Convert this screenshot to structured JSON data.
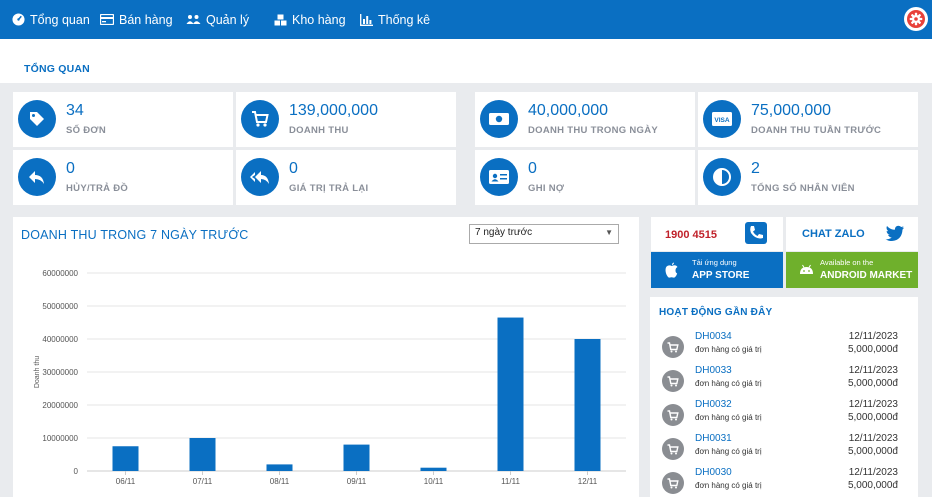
{
  "nav": {
    "items": [
      {
        "label": "Tổng quan",
        "icon": "dashboard-icon"
      },
      {
        "label": "Bán hàng",
        "icon": "card-icon"
      },
      {
        "label": "Quản lý",
        "icon": "users-icon"
      },
      {
        "label": "Kho hàng",
        "icon": "boxes-icon"
      },
      {
        "label": "Thống kê",
        "icon": "bar-chart-icon"
      }
    ],
    "settings_icon": "gear-icon"
  },
  "page": {
    "title": "TỔNG QUAN"
  },
  "stats": [
    {
      "value": "34",
      "label": "SỐ ĐƠN",
      "icon": "tag-icon"
    },
    {
      "value": "139,000,000",
      "label": "DOANH THU",
      "icon": "cart-icon"
    },
    {
      "value": "40,000,000",
      "label": "DOANH THU TRONG NGÀY",
      "icon": "money-icon"
    },
    {
      "value": "75,000,000",
      "label": "DOANH THU TUẦN TRƯỚC",
      "icon": "visa-icon"
    },
    {
      "value": "0",
      "label": "HỦY/TRẢ ĐỒ",
      "icon": "reply-icon"
    },
    {
      "value": "0",
      "label": "GIÁ TRỊ TRẢ LẠI",
      "icon": "reply-all-icon"
    },
    {
      "value": "0",
      "label": "GHI NỢ",
      "icon": "id-card-icon"
    },
    {
      "value": "2",
      "label": "TỔNG SỐ NHÂN VIÊN",
      "icon": "contrast-icon"
    }
  ],
  "chart_panel": {
    "title": "DOANH THU TRONG 7 NGÀY TRƯỚC",
    "select_value": "7 ngày trước"
  },
  "chart_data": {
    "type": "bar",
    "categories": [
      "06/11",
      "07/11",
      "08/11",
      "09/11",
      "10/11",
      "11/11",
      "12/11"
    ],
    "values": [
      7500000,
      10000000,
      2000000,
      8000000,
      1000000,
      46500000,
      40000000
    ],
    "ylabel": "Doanh thu",
    "ylim": [
      0,
      60000000
    ],
    "yticks": [
      "0",
      "10000000",
      "20000000",
      "30000000",
      "40000000",
      "50000000",
      "60000000"
    ],
    "bar_color": "#0a6fc2",
    "grid": true
  },
  "contact": {
    "phone": "1900 4515",
    "phone_icon": "phone-icon",
    "chat": "CHAT ZALO",
    "chat_icon": "twitter-icon"
  },
  "stores": {
    "apple": {
      "small": "Tải ứng dụng",
      "big": "APP STORE",
      "icon": "apple-icon",
      "color": "#0a6fc2"
    },
    "android": {
      "small": "Available on the",
      "big": "ANDROID MARKET",
      "icon": "android-icon",
      "color": "#6fb02c"
    }
  },
  "activity": {
    "title": "HOẠT ĐỘNG GẦN ĐÂY",
    "items": [
      {
        "code": "DH0034",
        "desc": "đơn hàng có giá trị",
        "date": "12/11/2023",
        "amount": "5,000,000đ"
      },
      {
        "code": "DH0033",
        "desc": "đơn hàng có giá trị",
        "date": "12/11/2023",
        "amount": "5,000,000đ"
      },
      {
        "code": "DH0032",
        "desc": "đơn hàng có giá trị",
        "date": "12/11/2023",
        "amount": "5,000,000đ"
      },
      {
        "code": "DH0031",
        "desc": "đơn hàng có giá trị",
        "date": "12/11/2023",
        "amount": "5,000,000đ"
      },
      {
        "code": "DH0030",
        "desc": "đơn hàng có giá trị",
        "date": "12/11/2023",
        "amount": "5,000,000đ"
      }
    ]
  }
}
